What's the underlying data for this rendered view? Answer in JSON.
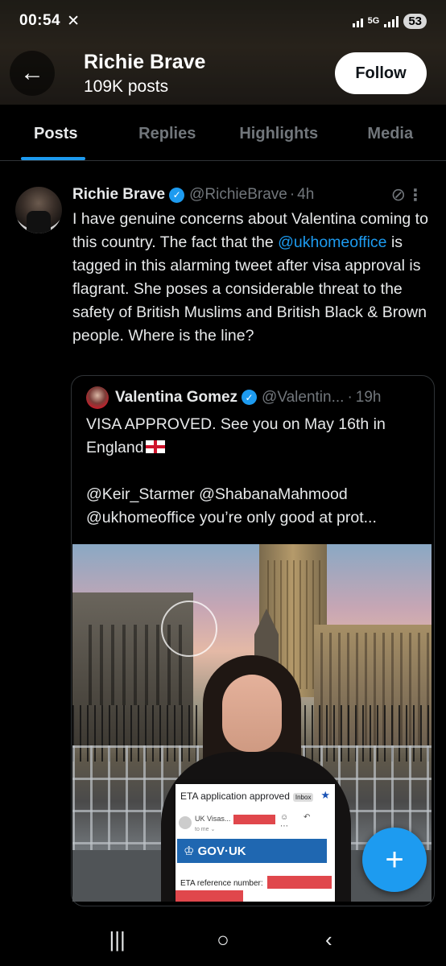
{
  "status_bar": {
    "time": "00:54",
    "x_icon": "x-logo-icon",
    "network": "5G",
    "battery": "53"
  },
  "header": {
    "back_icon": "arrow-left-icon",
    "name": "Richie Brave",
    "posts_count": "109K posts",
    "follow_label": "Follow"
  },
  "tabs": [
    {
      "label": "Posts",
      "active": true
    },
    {
      "label": "Replies",
      "active": false
    },
    {
      "label": "Highlights",
      "active": false
    },
    {
      "label": "Media",
      "active": false
    }
  ],
  "tweet": {
    "name": "Richie Brave",
    "handle": "@RichieBrave",
    "dot": "·",
    "time": "4h",
    "text_parts": [
      "I have genuine concerns about Valentina coming to this country. The fact that the ",
      "@ukhomeoffice",
      " is tagged in this alarming tweet after visa approval is flagrant. She poses a considerable threat to the safety of British Muslims and British Black & Brown people. Where is the line?"
    ]
  },
  "quote": {
    "name": "Valentina Gomez",
    "handle": "@Valentin...",
    "dot": "·",
    "time": "19h",
    "line1": "VISA APPROVED. See you on May 16th in England",
    "line2": "@Keir_Starmer @ShabanaMahmood @ukhomeoffice you’re only good at prot...",
    "image": {
      "eta_title": "ETA application approved",
      "eta_inbox": "Inbox",
      "eta_sender": "UK Visas...",
      "eta_to": "to me ⌄",
      "eta_actions": "☺ ↶ ⋯",
      "govuk": "♔ GOV·UK",
      "eta_ref": "ETA reference number:"
    }
  },
  "fab_label": "+",
  "navbar": {
    "recent": "|||",
    "home": "○",
    "back": "‹"
  },
  "colors": {
    "accent": "#1d9bf0",
    "text": "#e7e9ea",
    "muted": "#71767b",
    "border": "#2f3336"
  }
}
